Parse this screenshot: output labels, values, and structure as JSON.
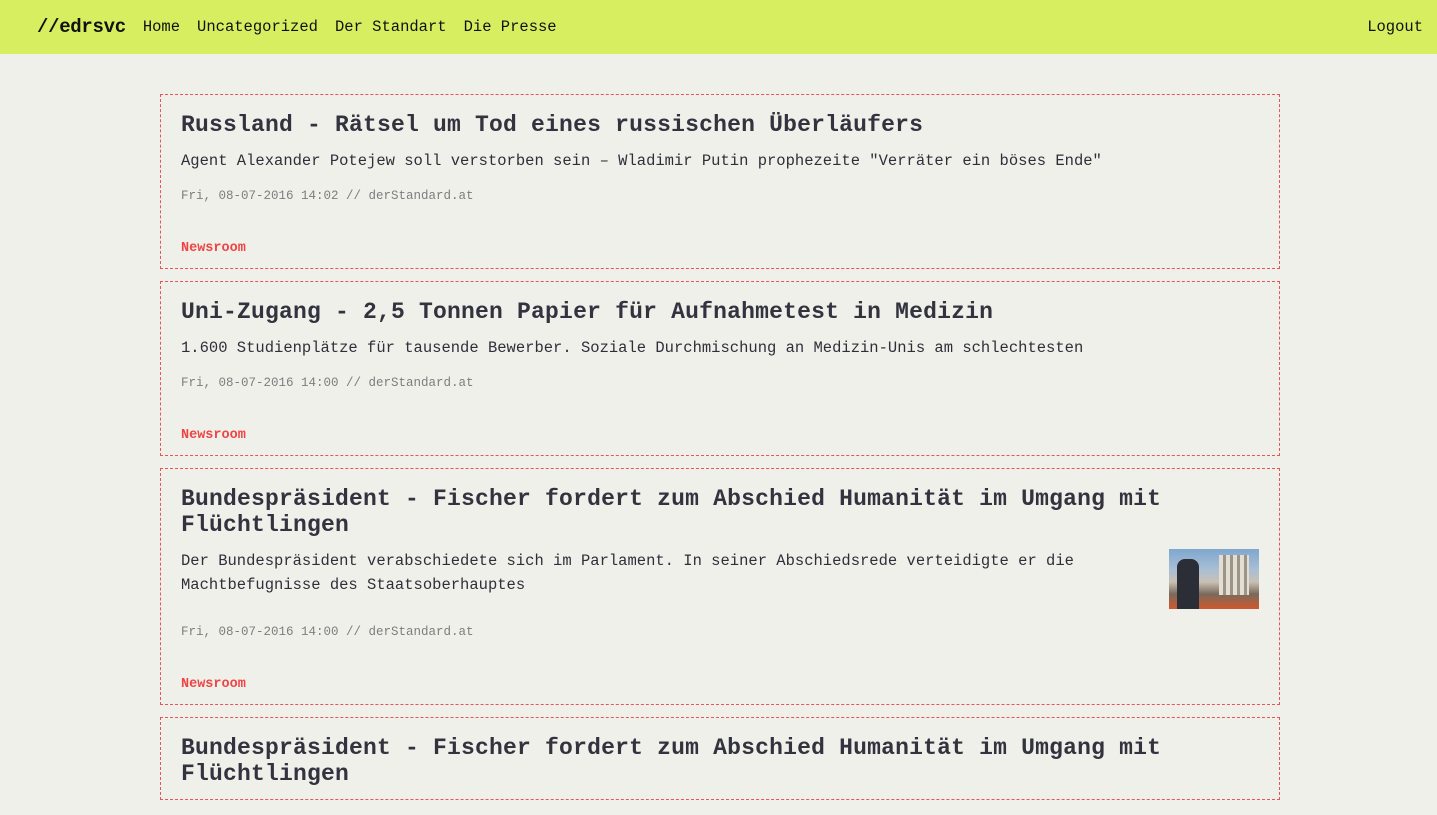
{
  "header": {
    "brand": "//edrsvc",
    "nav": [
      "Home",
      "Uncategorized",
      "Der Standart",
      "Die Presse"
    ],
    "logout": "Logout",
    "background": "#d6ee60"
  },
  "colors": {
    "page_background": "#f0f0eb",
    "card_border": "#e6555a",
    "tag": "#ee4444"
  },
  "articles": [
    {
      "title": "Russland - Rätsel um Tod eines russischen Überläufers",
      "description": "Agent Alexander Potejew soll verstorben sein – Wladimir Putin prophezeite \"Verräter ein böses Ende\"",
      "meta": "Fri, 08-07-2016 14:02 // derStandard.at",
      "tag": "Newsroom",
      "has_image": false
    },
    {
      "title": "Uni-Zugang - 2,5 Tonnen Papier für Aufnahmetest in Medizin",
      "description": "1.600 Studienplätze für tausende Bewerber. Soziale Durchmischung an Medizin-Unis am schlechtesten",
      "meta": "Fri, 08-07-2016 14:00 // derStandard.at",
      "tag": "Newsroom",
      "has_image": false
    },
    {
      "title": "Bundespräsident - Fischer fordert zum Abschied Humanität im Umgang mit Flüchtlingen",
      "description": "Der Bundespräsident verabschiedete sich im Parlament. In seiner Abschiedsrede verteidigte er die Machtbefugnisse des Staatsoberhauptes",
      "meta": "Fri, 08-07-2016 14:00 // derStandard.at",
      "tag": "Newsroom",
      "has_image": true
    },
    {
      "title": "Bundespräsident - Fischer fordert zum Abschied Humanität im Umgang mit Flüchtlingen",
      "description": "",
      "meta": "",
      "tag": "",
      "has_image": false
    }
  ]
}
